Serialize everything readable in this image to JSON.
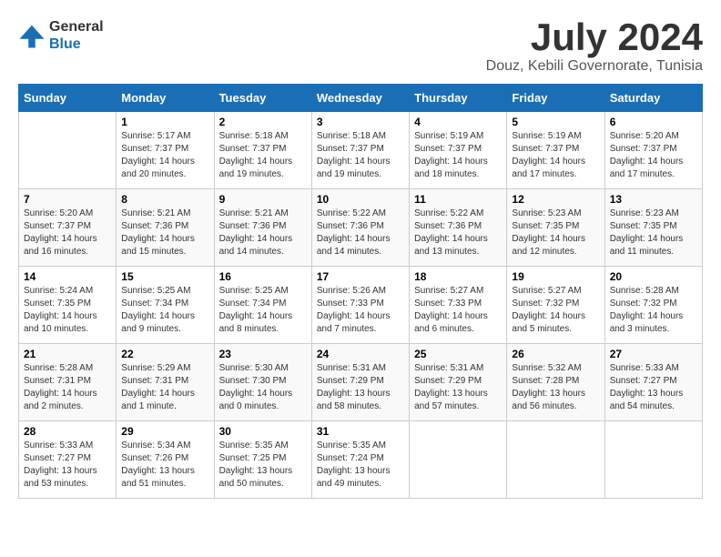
{
  "header": {
    "logo_general": "General",
    "logo_blue": "Blue",
    "month_title": "July 2024",
    "location": "Douz, Kebili Governorate, Tunisia"
  },
  "calendar": {
    "days_of_week": [
      "Sunday",
      "Monday",
      "Tuesday",
      "Wednesday",
      "Thursday",
      "Friday",
      "Saturday"
    ],
    "weeks": [
      [
        {
          "day": "",
          "info": ""
        },
        {
          "day": "1",
          "info": "Sunrise: 5:17 AM\nSunset: 7:37 PM\nDaylight: 14 hours\nand 20 minutes."
        },
        {
          "day": "2",
          "info": "Sunrise: 5:18 AM\nSunset: 7:37 PM\nDaylight: 14 hours\nand 19 minutes."
        },
        {
          "day": "3",
          "info": "Sunrise: 5:18 AM\nSunset: 7:37 PM\nDaylight: 14 hours\nand 19 minutes."
        },
        {
          "day": "4",
          "info": "Sunrise: 5:19 AM\nSunset: 7:37 PM\nDaylight: 14 hours\nand 18 minutes."
        },
        {
          "day": "5",
          "info": "Sunrise: 5:19 AM\nSunset: 7:37 PM\nDaylight: 14 hours\nand 17 minutes."
        },
        {
          "day": "6",
          "info": "Sunrise: 5:20 AM\nSunset: 7:37 PM\nDaylight: 14 hours\nand 17 minutes."
        }
      ],
      [
        {
          "day": "7",
          "info": "Sunrise: 5:20 AM\nSunset: 7:37 PM\nDaylight: 14 hours\nand 16 minutes."
        },
        {
          "day": "8",
          "info": "Sunrise: 5:21 AM\nSunset: 7:36 PM\nDaylight: 14 hours\nand 15 minutes."
        },
        {
          "day": "9",
          "info": "Sunrise: 5:21 AM\nSunset: 7:36 PM\nDaylight: 14 hours\nand 14 minutes."
        },
        {
          "day": "10",
          "info": "Sunrise: 5:22 AM\nSunset: 7:36 PM\nDaylight: 14 hours\nand 14 minutes."
        },
        {
          "day": "11",
          "info": "Sunrise: 5:22 AM\nSunset: 7:36 PM\nDaylight: 14 hours\nand 13 minutes."
        },
        {
          "day": "12",
          "info": "Sunrise: 5:23 AM\nSunset: 7:35 PM\nDaylight: 14 hours\nand 12 minutes."
        },
        {
          "day": "13",
          "info": "Sunrise: 5:23 AM\nSunset: 7:35 PM\nDaylight: 14 hours\nand 11 minutes."
        }
      ],
      [
        {
          "day": "14",
          "info": "Sunrise: 5:24 AM\nSunset: 7:35 PM\nDaylight: 14 hours\nand 10 minutes."
        },
        {
          "day": "15",
          "info": "Sunrise: 5:25 AM\nSunset: 7:34 PM\nDaylight: 14 hours\nand 9 minutes."
        },
        {
          "day": "16",
          "info": "Sunrise: 5:25 AM\nSunset: 7:34 PM\nDaylight: 14 hours\nand 8 minutes."
        },
        {
          "day": "17",
          "info": "Sunrise: 5:26 AM\nSunset: 7:33 PM\nDaylight: 14 hours\nand 7 minutes."
        },
        {
          "day": "18",
          "info": "Sunrise: 5:27 AM\nSunset: 7:33 PM\nDaylight: 14 hours\nand 6 minutes."
        },
        {
          "day": "19",
          "info": "Sunrise: 5:27 AM\nSunset: 7:32 PM\nDaylight: 14 hours\nand 5 minutes."
        },
        {
          "day": "20",
          "info": "Sunrise: 5:28 AM\nSunset: 7:32 PM\nDaylight: 14 hours\nand 3 minutes."
        }
      ],
      [
        {
          "day": "21",
          "info": "Sunrise: 5:28 AM\nSunset: 7:31 PM\nDaylight: 14 hours\nand 2 minutes."
        },
        {
          "day": "22",
          "info": "Sunrise: 5:29 AM\nSunset: 7:31 PM\nDaylight: 14 hours\nand 1 minute."
        },
        {
          "day": "23",
          "info": "Sunrise: 5:30 AM\nSunset: 7:30 PM\nDaylight: 14 hours\nand 0 minutes."
        },
        {
          "day": "24",
          "info": "Sunrise: 5:31 AM\nSunset: 7:29 PM\nDaylight: 13 hours\nand 58 minutes."
        },
        {
          "day": "25",
          "info": "Sunrise: 5:31 AM\nSunset: 7:29 PM\nDaylight: 13 hours\nand 57 minutes."
        },
        {
          "day": "26",
          "info": "Sunrise: 5:32 AM\nSunset: 7:28 PM\nDaylight: 13 hours\nand 56 minutes."
        },
        {
          "day": "27",
          "info": "Sunrise: 5:33 AM\nSunset: 7:27 PM\nDaylight: 13 hours\nand 54 minutes."
        }
      ],
      [
        {
          "day": "28",
          "info": "Sunrise: 5:33 AM\nSunset: 7:27 PM\nDaylight: 13 hours\nand 53 minutes."
        },
        {
          "day": "29",
          "info": "Sunrise: 5:34 AM\nSunset: 7:26 PM\nDaylight: 13 hours\nand 51 minutes."
        },
        {
          "day": "30",
          "info": "Sunrise: 5:35 AM\nSunset: 7:25 PM\nDaylight: 13 hours\nand 50 minutes."
        },
        {
          "day": "31",
          "info": "Sunrise: 5:35 AM\nSunset: 7:24 PM\nDaylight: 13 hours\nand 49 minutes."
        },
        {
          "day": "",
          "info": ""
        },
        {
          "day": "",
          "info": ""
        },
        {
          "day": "",
          "info": ""
        }
      ]
    ]
  }
}
